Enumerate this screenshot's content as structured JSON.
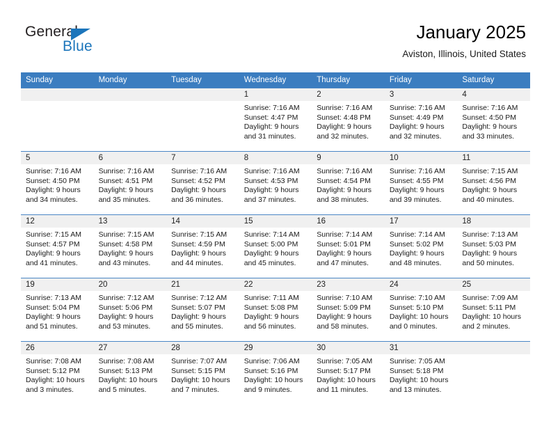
{
  "brand": {
    "name_part1": "General",
    "name_part2": "Blue",
    "logo_icon": "triangle-flag-icon"
  },
  "header": {
    "title": "January 2025",
    "subtitle": "Aviston, Illinois, United States"
  },
  "theme": {
    "header_blue": "#3b7dc0",
    "brand_blue": "#1b75bb",
    "daynum_band": "#f0f0f0",
    "row_divider": "#4a86c5"
  },
  "weekday_headers": [
    "Sunday",
    "Monday",
    "Tuesday",
    "Wednesday",
    "Thursday",
    "Friday",
    "Saturday"
  ],
  "labels": {
    "sunrise_prefix": "Sunrise:",
    "sunset_prefix": "Sunset:",
    "daylight_prefix": "Daylight:"
  },
  "weeks": [
    [
      {
        "day": "",
        "empty": true,
        "l1": "",
        "l2": "",
        "l3": "",
        "l4": ""
      },
      {
        "day": "",
        "empty": true,
        "l1": "",
        "l2": "",
        "l3": "",
        "l4": ""
      },
      {
        "day": "",
        "empty": true,
        "l1": "",
        "l2": "",
        "l3": "",
        "l4": ""
      },
      {
        "day": "1",
        "empty": false,
        "l1": "Sunrise: 7:16 AM",
        "l2": "Sunset: 4:47 PM",
        "l3": "Daylight: 9 hours",
        "l4": "and 31 minutes."
      },
      {
        "day": "2",
        "empty": false,
        "l1": "Sunrise: 7:16 AM",
        "l2": "Sunset: 4:48 PM",
        "l3": "Daylight: 9 hours",
        "l4": "and 32 minutes."
      },
      {
        "day": "3",
        "empty": false,
        "l1": "Sunrise: 7:16 AM",
        "l2": "Sunset: 4:49 PM",
        "l3": "Daylight: 9 hours",
        "l4": "and 32 minutes."
      },
      {
        "day": "4",
        "empty": false,
        "l1": "Sunrise: 7:16 AM",
        "l2": "Sunset: 4:50 PM",
        "l3": "Daylight: 9 hours",
        "l4": "and 33 minutes."
      }
    ],
    [
      {
        "day": "5",
        "empty": false,
        "l1": "Sunrise: 7:16 AM",
        "l2": "Sunset: 4:50 PM",
        "l3": "Daylight: 9 hours",
        "l4": "and 34 minutes."
      },
      {
        "day": "6",
        "empty": false,
        "l1": "Sunrise: 7:16 AM",
        "l2": "Sunset: 4:51 PM",
        "l3": "Daylight: 9 hours",
        "l4": "and 35 minutes."
      },
      {
        "day": "7",
        "empty": false,
        "l1": "Sunrise: 7:16 AM",
        "l2": "Sunset: 4:52 PM",
        "l3": "Daylight: 9 hours",
        "l4": "and 36 minutes."
      },
      {
        "day": "8",
        "empty": false,
        "l1": "Sunrise: 7:16 AM",
        "l2": "Sunset: 4:53 PM",
        "l3": "Daylight: 9 hours",
        "l4": "and 37 minutes."
      },
      {
        "day": "9",
        "empty": false,
        "l1": "Sunrise: 7:16 AM",
        "l2": "Sunset: 4:54 PM",
        "l3": "Daylight: 9 hours",
        "l4": "and 38 minutes."
      },
      {
        "day": "10",
        "empty": false,
        "l1": "Sunrise: 7:16 AM",
        "l2": "Sunset: 4:55 PM",
        "l3": "Daylight: 9 hours",
        "l4": "and 39 minutes."
      },
      {
        "day": "11",
        "empty": false,
        "l1": "Sunrise: 7:15 AM",
        "l2": "Sunset: 4:56 PM",
        "l3": "Daylight: 9 hours",
        "l4": "and 40 minutes."
      }
    ],
    [
      {
        "day": "12",
        "empty": false,
        "l1": "Sunrise: 7:15 AM",
        "l2": "Sunset: 4:57 PM",
        "l3": "Daylight: 9 hours",
        "l4": "and 41 minutes."
      },
      {
        "day": "13",
        "empty": false,
        "l1": "Sunrise: 7:15 AM",
        "l2": "Sunset: 4:58 PM",
        "l3": "Daylight: 9 hours",
        "l4": "and 43 minutes."
      },
      {
        "day": "14",
        "empty": false,
        "l1": "Sunrise: 7:15 AM",
        "l2": "Sunset: 4:59 PM",
        "l3": "Daylight: 9 hours",
        "l4": "and 44 minutes."
      },
      {
        "day": "15",
        "empty": false,
        "l1": "Sunrise: 7:14 AM",
        "l2": "Sunset: 5:00 PM",
        "l3": "Daylight: 9 hours",
        "l4": "and 45 minutes."
      },
      {
        "day": "16",
        "empty": false,
        "l1": "Sunrise: 7:14 AM",
        "l2": "Sunset: 5:01 PM",
        "l3": "Daylight: 9 hours",
        "l4": "and 47 minutes."
      },
      {
        "day": "17",
        "empty": false,
        "l1": "Sunrise: 7:14 AM",
        "l2": "Sunset: 5:02 PM",
        "l3": "Daylight: 9 hours",
        "l4": "and 48 minutes."
      },
      {
        "day": "18",
        "empty": false,
        "l1": "Sunrise: 7:13 AM",
        "l2": "Sunset: 5:03 PM",
        "l3": "Daylight: 9 hours",
        "l4": "and 50 minutes."
      }
    ],
    [
      {
        "day": "19",
        "empty": false,
        "l1": "Sunrise: 7:13 AM",
        "l2": "Sunset: 5:04 PM",
        "l3": "Daylight: 9 hours",
        "l4": "and 51 minutes."
      },
      {
        "day": "20",
        "empty": false,
        "l1": "Sunrise: 7:12 AM",
        "l2": "Sunset: 5:06 PM",
        "l3": "Daylight: 9 hours",
        "l4": "and 53 minutes."
      },
      {
        "day": "21",
        "empty": false,
        "l1": "Sunrise: 7:12 AM",
        "l2": "Sunset: 5:07 PM",
        "l3": "Daylight: 9 hours",
        "l4": "and 55 minutes."
      },
      {
        "day": "22",
        "empty": false,
        "l1": "Sunrise: 7:11 AM",
        "l2": "Sunset: 5:08 PM",
        "l3": "Daylight: 9 hours",
        "l4": "and 56 minutes."
      },
      {
        "day": "23",
        "empty": false,
        "l1": "Sunrise: 7:10 AM",
        "l2": "Sunset: 5:09 PM",
        "l3": "Daylight: 9 hours",
        "l4": "and 58 minutes."
      },
      {
        "day": "24",
        "empty": false,
        "l1": "Sunrise: 7:10 AM",
        "l2": "Sunset: 5:10 PM",
        "l3": "Daylight: 10 hours",
        "l4": "and 0 minutes."
      },
      {
        "day": "25",
        "empty": false,
        "l1": "Sunrise: 7:09 AM",
        "l2": "Sunset: 5:11 PM",
        "l3": "Daylight: 10 hours",
        "l4": "and 2 minutes."
      }
    ],
    [
      {
        "day": "26",
        "empty": false,
        "l1": "Sunrise: 7:08 AM",
        "l2": "Sunset: 5:12 PM",
        "l3": "Daylight: 10 hours",
        "l4": "and 3 minutes."
      },
      {
        "day": "27",
        "empty": false,
        "l1": "Sunrise: 7:08 AM",
        "l2": "Sunset: 5:13 PM",
        "l3": "Daylight: 10 hours",
        "l4": "and 5 minutes."
      },
      {
        "day": "28",
        "empty": false,
        "l1": "Sunrise: 7:07 AM",
        "l2": "Sunset: 5:15 PM",
        "l3": "Daylight: 10 hours",
        "l4": "and 7 minutes."
      },
      {
        "day": "29",
        "empty": false,
        "l1": "Sunrise: 7:06 AM",
        "l2": "Sunset: 5:16 PM",
        "l3": "Daylight: 10 hours",
        "l4": "and 9 minutes."
      },
      {
        "day": "30",
        "empty": false,
        "l1": "Sunrise: 7:05 AM",
        "l2": "Sunset: 5:17 PM",
        "l3": "Daylight: 10 hours",
        "l4": "and 11 minutes."
      },
      {
        "day": "31",
        "empty": false,
        "l1": "Sunrise: 7:05 AM",
        "l2": "Sunset: 5:18 PM",
        "l3": "Daylight: 10 hours",
        "l4": "and 13 minutes."
      },
      {
        "day": "",
        "empty": true,
        "l1": "",
        "l2": "",
        "l3": "",
        "l4": ""
      }
    ]
  ]
}
